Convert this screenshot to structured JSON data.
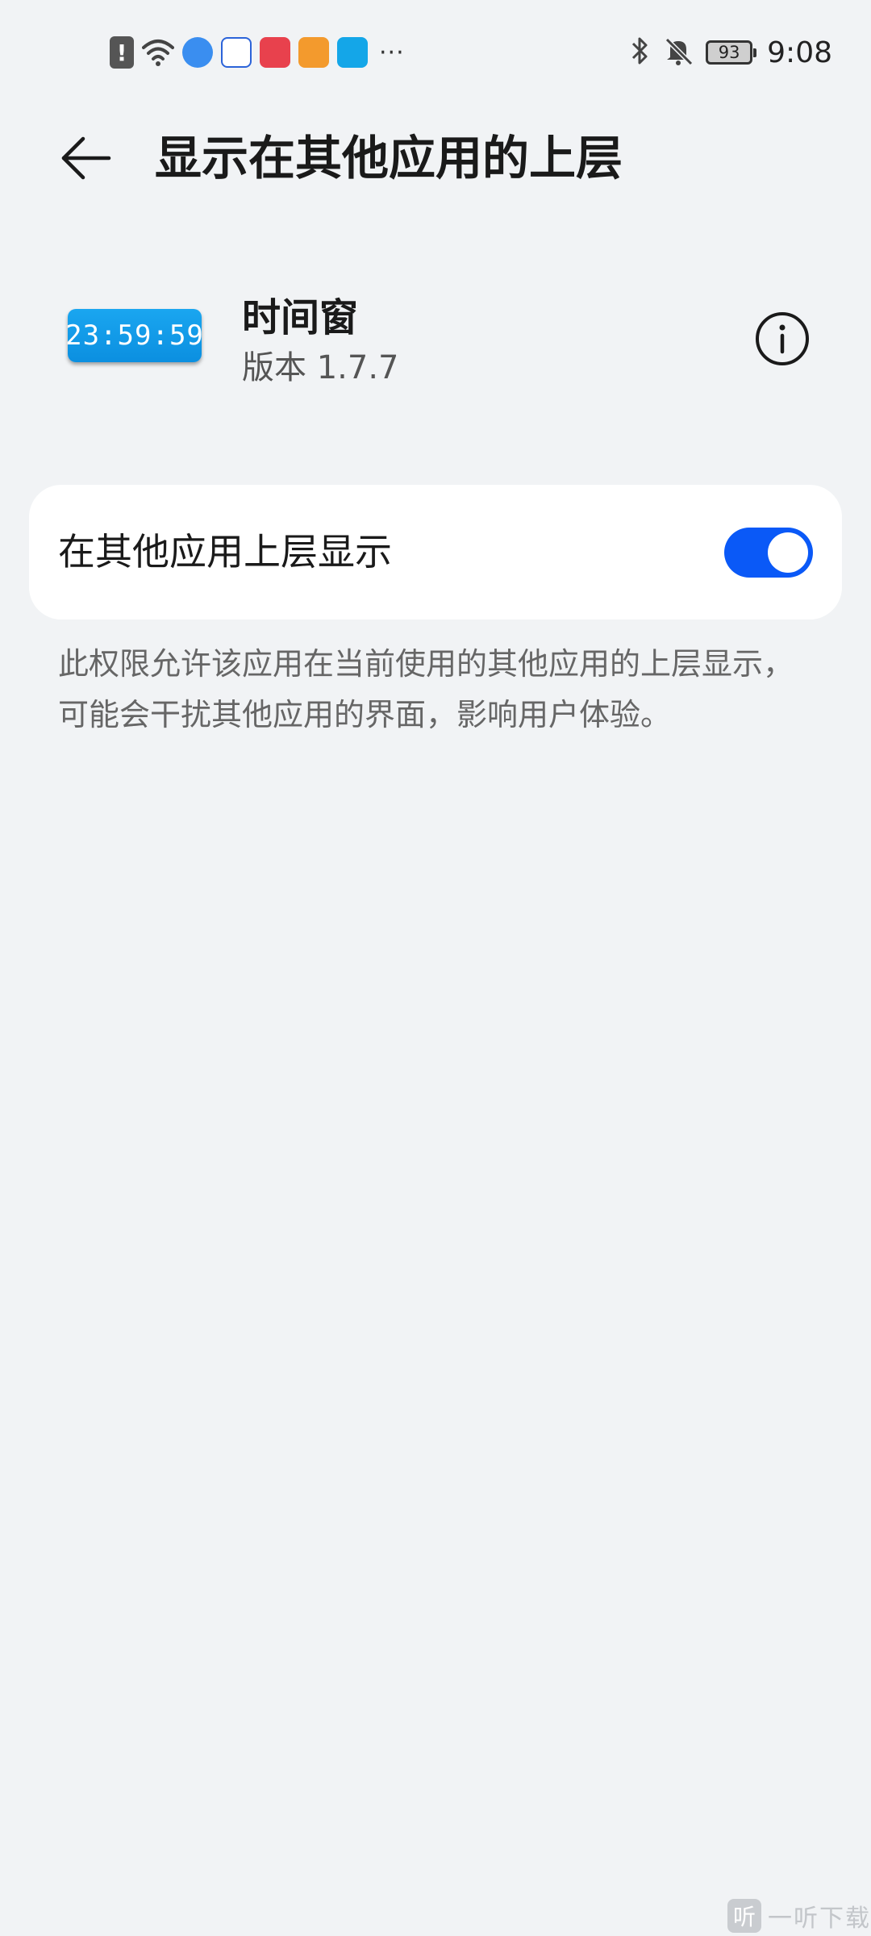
{
  "status_bar": {
    "notification_icons": [
      "alert-icon",
      "wifi-icon",
      "browser-app-icon",
      "baidu-app-icon",
      "huawei-store-app-icon",
      "video-app-icon",
      "search-app-icon"
    ],
    "more_indicator": "···",
    "battery_level": "93",
    "time": "9:08"
  },
  "title_bar": {
    "title": "显示在其他应用的上层"
  },
  "app": {
    "icon_text": "23:59:59",
    "name": "时间窗",
    "version": "版本 1.7.7"
  },
  "permission": {
    "label": "在其他应用上层显示",
    "enabled": true
  },
  "description": "此权限允许该应用在当前使用的其他应用的上层显示，可能会干扰其他应用的界面，影响用户体验。",
  "watermark": {
    "badge": "听",
    "text": "一听下载"
  },
  "colors": {
    "background": "#f1f3f5",
    "accent": "#0a59f7",
    "card": "#ffffff",
    "app_icon": "#1aa6f0"
  }
}
